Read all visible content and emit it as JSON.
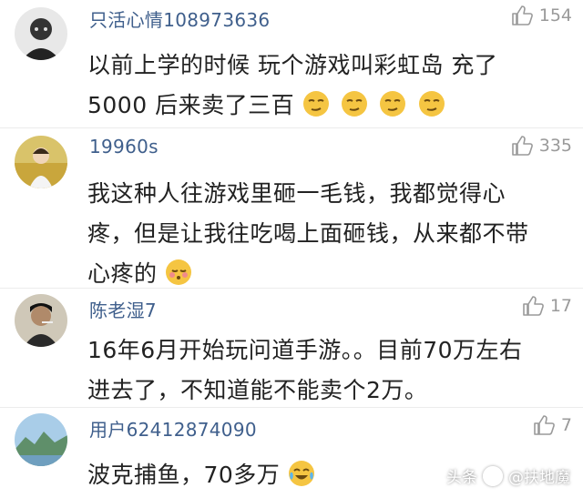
{
  "colors": {
    "username": "#3f5f8c",
    "likes": "#9a9a9a",
    "text": "#222222",
    "emoji": "#f5c542"
  },
  "comments": [
    {
      "username": "只活心情108973636",
      "likes": "154",
      "lines": [
        "以前上学的时候  玩个游戏叫彩虹岛    充了",
        "5000  后来卖了三百"
      ],
      "emoji_count": 4,
      "emoji_icon": "smirk-face-icon"
    },
    {
      "username": "19960s",
      "likes": "335",
      "lines": [
        "我这种人往游戏里砸一毛钱，我都觉得心",
        "疼，但是让我往吃喝上面砸钱，从来都不带",
        "心疼的"
      ],
      "emoji_count": 1,
      "emoji_icon": "blushing-face-icon"
    },
    {
      "username": "陈老湿7",
      "likes": "17",
      "lines": [
        "16年6月开始玩问道手游。。目前70万左右",
        "进去了，不知道能不能卖个2万。"
      ]
    },
    {
      "username": "用户62412874090",
      "likes": "7",
      "lines": [
        "波克捕鱼，70多万"
      ],
      "emoji_count": 1,
      "emoji_icon": "tears-of-joy-icon"
    }
  ],
  "watermark": {
    "prefix": "头条",
    "handle": "@扶地魔"
  }
}
